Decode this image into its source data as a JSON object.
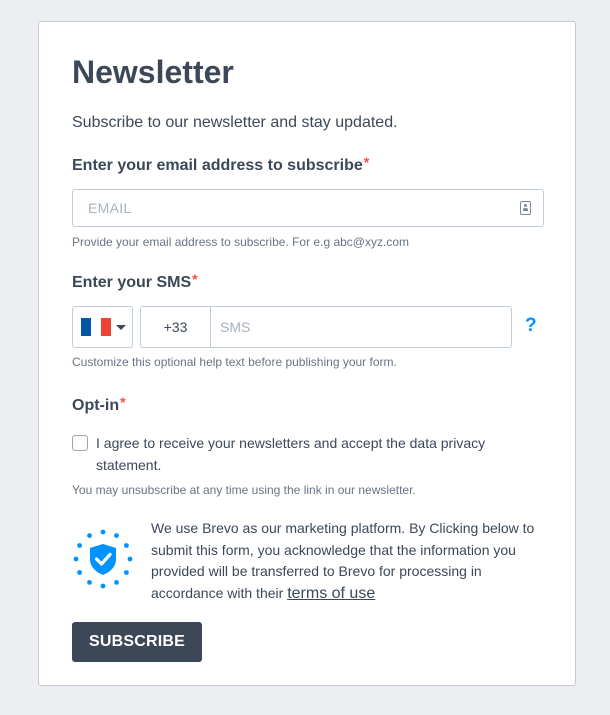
{
  "form": {
    "title": "Newsletter",
    "subtitle": "Subscribe to our newsletter and stay updated.",
    "email": {
      "label": "Enter your email address to subscribe",
      "required_mark": "*",
      "placeholder": "EMAIL",
      "value": "",
      "help": "Provide your email address to subscribe. For e.g abc@xyz.com",
      "icon": "contact-card-icon"
    },
    "sms": {
      "label": "Enter your SMS",
      "required_mark": "*",
      "country_flag": "France",
      "flag_colors": [
        "#0055a4",
        "#ffffff",
        "#ef4135"
      ],
      "dial_code": "+33",
      "placeholder": "SMS",
      "value": "",
      "help_icon": "?",
      "help": "Customize this optional help text before publishing your form."
    },
    "optin": {
      "label": "Opt-in",
      "required_mark": "*",
      "checked": false,
      "checkbox_text": "I agree to receive your newsletters and accept the data privacy statement.",
      "help": "You may unsubscribe at any time using the link in our newsletter."
    },
    "gdpr": {
      "text": "We use Brevo as our marketing platform. By Clicking below to submit this form, you acknowledge that the information you provided will be transferred to Brevo for processing in accordance with their",
      "link_text": "terms of use",
      "badge_icon": "shield-check-icon",
      "badge_color": "#0092ff"
    },
    "submit_label": "SUBSCRIBE"
  },
  "colors": {
    "page_bg": "#eceef2",
    "text": "#3c4858",
    "required": "#ff4949",
    "accent": "#0092ff",
    "button_bg": "#3c4858"
  }
}
